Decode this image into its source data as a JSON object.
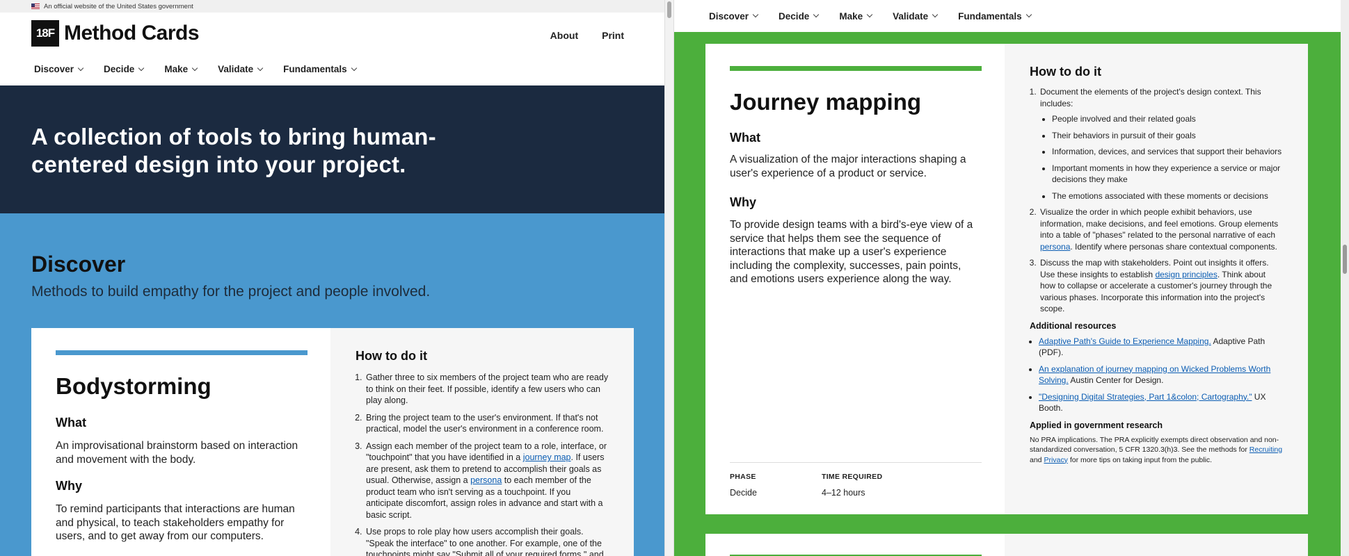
{
  "left": {
    "gov_banner": "An official website of the United States government",
    "logo": "18F",
    "site_title": "Method Cards",
    "header_links": [
      "About",
      "Print"
    ],
    "nav": [
      "Discover",
      "Decide",
      "Make",
      "Validate",
      "Fundamentals"
    ],
    "hero_title": "A collection of tools to bring human-centered design into your project.",
    "section_title": "Discover",
    "section_sub": "Methods to build empathy for the project and people involved.",
    "card": {
      "title": "Bodystorming",
      "what_label": "What",
      "what_text": "An improvisational brainstorm based on interaction and movement with the body.",
      "why_label": "Why",
      "why_text": "To remind participants that interactions are human and physical, to teach stakeholders empathy for users, and to get away from our computers.",
      "how_label": "How to do it",
      "steps": {
        "s1": "Gather three to six members of the project team who are ready to think on their feet. If possible, identify a few users who can play along.",
        "s2": "Bring the project team to the user's environment. If that's not practical, model the user's environment in a conference room.",
        "s3a": "Assign each member of the project team to a role, interface, or \"touchpoint\" that you have identified in a",
        "s3_link1": "journey map",
        "s3b": ". If users are present, ask them to pretend to accomplish their goals as usual. Otherwise, assign a",
        "s3_link2": "persona",
        "s3c": "to each member of the product team who isn't serving as a touchpoint. If you anticipate discomfort, assign roles in advance and start with a basic script.",
        "s4": "Use props to role play how users accomplish their goals. \"Speak the interface\" to one another. For example, one of the touchpoints might say \"Submit all of your required forms,\" and"
      }
    }
  },
  "right": {
    "nav": [
      "Discover",
      "Decide",
      "Make",
      "Validate",
      "Fundamentals"
    ],
    "card": {
      "title": "Journey mapping",
      "what_label": "What",
      "what_text": "A visualization of the major interactions shaping a user's experience of a product or service.",
      "why_label": "Why",
      "why_text": "To provide design teams with a bird's-eye view of a service that helps them see the sequence of interactions that make up a user's experience including the complexity, successes, pain points, and emotions users experience along the way.",
      "phase_label": "PHASE",
      "phase_value": "Decide",
      "time_label": "TIME REQUIRED",
      "time_value": "4–12 hours",
      "how_label": "How to do it",
      "step1": "Document the elements of the project's design context. This includes:",
      "step1_items": [
        "People involved and their related goals",
        "Their behaviors in pursuit of their goals",
        "Information, devices, and services that support their behaviors",
        "Important moments in how they experience a service or major decisions they make",
        "The emotions associated with these moments or decisions"
      ],
      "step2a": "Visualize the order in which people exhibit behaviors, use information, make decisions, and feel emotions. Group elements into a table of \"phases\" related to the personal narrative of each",
      "step2_link": "persona",
      "step2b": ". Identify where personas share contextual components.",
      "step3a": "Discuss the map with stakeholders. Point out insights it offers. Use these insights to establish",
      "step3_link": "design principles",
      "step3b": ". Think about how to collapse or accelerate a customer's journey through the various phases. Incorporate this information into the project's scope.",
      "resources_label": "Additional resources",
      "res1_link": "Adaptive Path's Guide to Experience Mapping.",
      "res1_text": "Adaptive Path (PDF).",
      "res2_link": "An explanation of journey mapping on Wicked Problems Worth Solving.",
      "res2_text": "Austin Center for Design.",
      "res3_link": "\"Designing Digital Strategies, Part 1&colon; Cartography.\"",
      "res3_text": "UX Booth.",
      "gov_label": "Applied in government research",
      "gov_text_a": "No PRA implications. The PRA explicitly exempts direct observation and non-standardized conversation, 5 CFR 1320.3(h)3. See the methods for",
      "gov_link1": "Recruiting",
      "gov_and": "and",
      "gov_link2": "Privacy",
      "gov_text_b": "for more tips on taking input from the public."
    }
  },
  "colors": {
    "hero_bg": "#1b2a40",
    "discover_blue": "#4a98ce",
    "decide_green": "#4caf3c",
    "link": "#0b5db3"
  }
}
